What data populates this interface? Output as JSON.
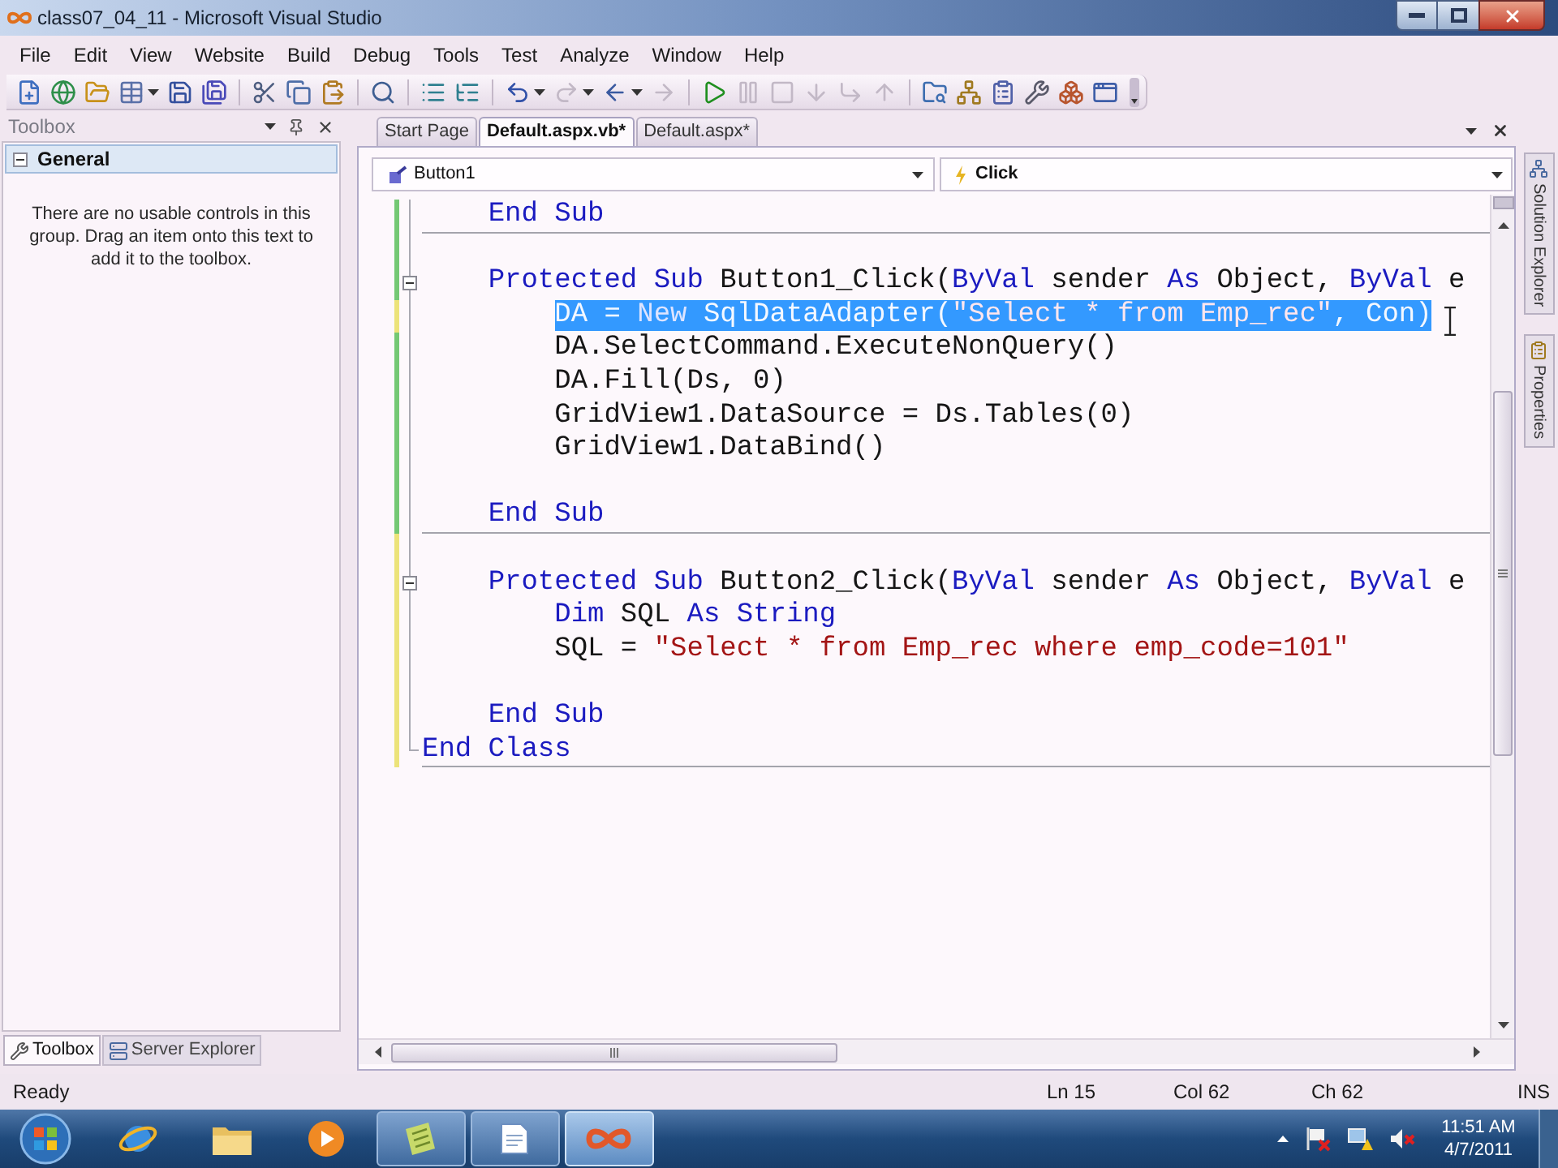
{
  "window": {
    "title": "class07_04_11 - Microsoft Visual Studio"
  },
  "menu": [
    "File",
    "Edit",
    "View",
    "Website",
    "Build",
    "Debug",
    "Tools",
    "Test",
    "Analyze",
    "Window",
    "Help"
  ],
  "toolbar": [
    {
      "kind": "project",
      "disabled": false
    },
    {
      "kind": "website",
      "disabled": false
    },
    {
      "kind": "open",
      "disabled": false
    },
    {
      "kind": "additem",
      "disabled": false
    },
    {
      "kind": "caret"
    },
    {
      "kind": "save",
      "disabled": false
    },
    {
      "kind": "saveall",
      "disabled": false
    },
    {
      "kind": "separator"
    },
    {
      "kind": "cut",
      "disabled": false
    },
    {
      "kind": "copy",
      "disabled": false
    },
    {
      "kind": "paste",
      "disabled": false
    },
    {
      "kind": "separator"
    },
    {
      "kind": "find",
      "disabled": false
    },
    {
      "kind": "separator"
    },
    {
      "kind": "comment",
      "disabled": false
    },
    {
      "kind": "uncomment",
      "disabled": false
    },
    {
      "kind": "separator"
    },
    {
      "kind": "undo",
      "disabled": false
    },
    {
      "kind": "caret"
    },
    {
      "kind": "redo",
      "disabled": true
    },
    {
      "kind": "caret"
    },
    {
      "kind": "back",
      "disabled": false
    },
    {
      "kind": "caret"
    },
    {
      "kind": "forward",
      "disabled": true
    },
    {
      "kind": "separator"
    },
    {
      "kind": "start",
      "disabled": false
    },
    {
      "kind": "pause",
      "disabled": true
    },
    {
      "kind": "stop",
      "disabled": true
    },
    {
      "kind": "stepinto",
      "disabled": true
    },
    {
      "kind": "stepover",
      "disabled": true
    },
    {
      "kind": "stepout",
      "disabled": true
    },
    {
      "kind": "separator"
    },
    {
      "kind": "findfiles",
      "disabled": false
    },
    {
      "kind": "solution",
      "disabled": false
    },
    {
      "kind": "properties",
      "disabled": false
    },
    {
      "kind": "toolbox",
      "disabled": false
    },
    {
      "kind": "browser",
      "disabled": false
    },
    {
      "kind": "startpage",
      "disabled": false
    },
    {
      "kind": "overflow"
    }
  ],
  "toolbox": {
    "title": "Toolbox",
    "group": {
      "label": "General",
      "expanded": true
    },
    "message": "There are no usable controls in this group. Drag an item onto this text to add it to the toolbox.",
    "tabs": [
      {
        "label": "Toolbox",
        "selected": true
      },
      {
        "label": "Server Explorer",
        "selected": false
      }
    ]
  },
  "editor": {
    "tabs": [
      {
        "label": "Start Page",
        "selected": false
      },
      {
        "label": "Default.aspx.vb*",
        "selected": true
      },
      {
        "label": "Default.aspx*",
        "selected": false
      }
    ],
    "class_dropdown": "Button1",
    "method_dropdown": "Click",
    "lines": [
      {
        "kind": "code",
        "selected": false,
        "color": "#74c874",
        "separator_below": true,
        "tokens": [
          {
            "kind": "keyword",
            "text": "    End Sub"
          }
        ]
      },
      {
        "kind": "blank",
        "selected": false,
        "color": "#74c874",
        "separator_below": false
      },
      {
        "kind": "code",
        "selected": false,
        "color": "#74c874",
        "separator_below": false,
        "expanded": true,
        "tokens": [
          {
            "kind": "keyword",
            "text": "    Protected Sub "
          },
          {
            "kind": "plain",
            "text": "Button1_Click("
          },
          {
            "kind": "keyword",
            "text": "ByVal"
          },
          {
            "kind": "plain",
            "text": " sender "
          },
          {
            "kind": "keyword",
            "text": "As"
          },
          {
            "kind": "plain",
            "text": " Object, "
          },
          {
            "kind": "keyword",
            "text": "ByVal"
          },
          {
            "kind": "plain",
            "text": " e"
          }
        ]
      },
      {
        "kind": "code",
        "selected": true,
        "color": "#ece37a",
        "separator_below": false,
        "tokens": [
          {
            "kind": "plain",
            "text": "        DA = "
          },
          {
            "kind": "keyword",
            "text": "New"
          },
          {
            "kind": "plain",
            "text": " SqlDataAdapter("
          },
          {
            "kind": "string",
            "text": "\"Select * from Emp_rec\""
          },
          {
            "kind": "plain",
            "text": ", Con)"
          }
        ]
      },
      {
        "kind": "code",
        "selected": false,
        "color": "#74c874",
        "separator_below": false,
        "tokens": [
          {
            "kind": "plain",
            "text": "        DA.SelectCommand.ExecuteNonQuery()"
          }
        ]
      },
      {
        "kind": "code",
        "selected": false,
        "color": "#74c874",
        "separator_below": false,
        "tokens": [
          {
            "kind": "plain",
            "text": "        DA.Fill(Ds, 0)"
          }
        ]
      },
      {
        "kind": "code",
        "selected": false,
        "color": "#74c874",
        "separator_below": false,
        "tokens": [
          {
            "kind": "plain",
            "text": "        GridView1.DataSource = Ds.Tables(0)"
          }
        ]
      },
      {
        "kind": "code",
        "selected": false,
        "color": "#74c874",
        "separator_below": false,
        "tokens": [
          {
            "kind": "plain",
            "text": "        GridView1.DataBind()"
          }
        ]
      },
      {
        "kind": "blank",
        "selected": false,
        "color": "#74c874",
        "separator_below": false
      },
      {
        "kind": "code",
        "selected": false,
        "color": "#74c874",
        "separator_below": true,
        "tokens": [
          {
            "kind": "keyword",
            "text": "    End Sub"
          }
        ]
      },
      {
        "kind": "blank",
        "selected": false,
        "color": "#ece37a",
        "separator_below": false
      },
      {
        "kind": "code",
        "selected": false,
        "color": "#ece37a",
        "separator_below": false,
        "expanded": true,
        "tokens": [
          {
            "kind": "keyword",
            "text": "    Protected Sub "
          },
          {
            "kind": "plain",
            "text": "Button2_Click("
          },
          {
            "kind": "keyword",
            "text": "ByVal"
          },
          {
            "kind": "plain",
            "text": " sender "
          },
          {
            "kind": "keyword",
            "text": "As"
          },
          {
            "kind": "plain",
            "text": " Object, "
          },
          {
            "kind": "keyword",
            "text": "ByVal"
          },
          {
            "kind": "plain",
            "text": " e"
          }
        ]
      },
      {
        "kind": "code",
        "selected": false,
        "color": "#ece37a",
        "separator_below": false,
        "tokens": [
          {
            "kind": "keyword",
            "text": "        Dim"
          },
          {
            "kind": "plain",
            "text": " SQL "
          },
          {
            "kind": "keyword",
            "text": "As String"
          }
        ]
      },
      {
        "kind": "code",
        "selected": false,
        "color": "#ece37a",
        "separator_below": false,
        "tokens": [
          {
            "kind": "plain",
            "text": "        SQL = "
          },
          {
            "kind": "string",
            "text": "\"Select * from Emp_rec where emp_code=101\""
          }
        ]
      },
      {
        "kind": "blank",
        "selected": false,
        "color": "#ece37a",
        "separator_below": false
      },
      {
        "kind": "code",
        "selected": false,
        "color": "#ece37a",
        "separator_below": false,
        "tokens": [
          {
            "kind": "keyword",
            "text": "    End Sub"
          }
        ]
      },
      {
        "kind": "code",
        "selected": false,
        "color": "#ece37a",
        "separator_below": true,
        "tokens": [
          {
            "kind": "keyword",
            "text": "End Class"
          }
        ]
      }
    ]
  },
  "side_tabs": [
    "Solution Explorer",
    "Properties"
  ],
  "status_bar": {
    "message": "Ready",
    "line": "Ln 15",
    "column": "Col 62",
    "char": "Ch 62",
    "mode": "INS"
  },
  "taskbar": {
    "apps": [
      {
        "kind": "browser",
        "running": false,
        "selected": false
      },
      {
        "kind": "folder",
        "running": false,
        "selected": false
      },
      {
        "kind": "media",
        "running": false,
        "selected": false
      },
      {
        "kind": "notes",
        "running": true,
        "selected": false
      },
      {
        "kind": "document",
        "running": true,
        "selected": false
      },
      {
        "kind": "studio",
        "running": true,
        "selected": true
      }
    ],
    "time": "11:51 AM",
    "date": "4/7/2011"
  }
}
